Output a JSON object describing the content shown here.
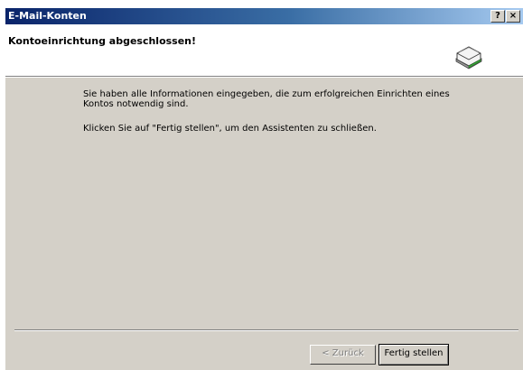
{
  "window": {
    "title": "E-Mail-Konten",
    "help_glyph": "?",
    "close_glyph": "×"
  },
  "header": {
    "heading": "Kontoeinrichtung abgeschlossen!",
    "icon": "mail-envelope-icon"
  },
  "body": {
    "paragraph1": "Sie haben alle Informationen eingegeben, die zum erfolgreichen Einrichten eines Kontos notwendig sind.",
    "paragraph2": "Klicken Sie auf \"Fertig stellen\", um den Assistenten zu schließen."
  },
  "buttons": {
    "back_label": "< Zurück",
    "back_enabled": false,
    "finish_label": "Fertig stellen"
  }
}
